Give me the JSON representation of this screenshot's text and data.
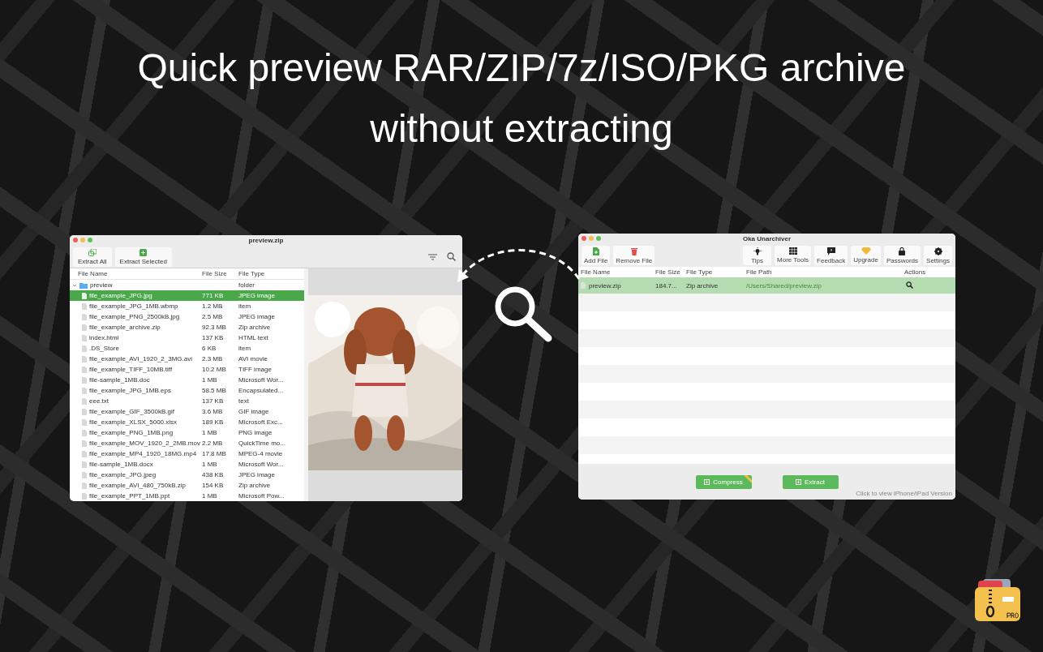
{
  "headline": "Quick preview RAR/ZIP/7z/ISO/PKG archive without extracting",
  "preview_window": {
    "title": "preview.zip",
    "toolbar": [
      {
        "label": "Extract All"
      },
      {
        "label": "Extract Selected"
      }
    ],
    "columns": [
      "File Name",
      "File Size",
      "File Type"
    ],
    "tree": [
      {
        "name": "preview",
        "type": "folder",
        "expanded": true,
        "selected": false,
        "children": [
          {
            "name": "file_example_JPG.jpg",
            "size": "771 KB",
            "type": "JPEG image",
            "selected": true
          },
          {
            "name": "file_example_JPG_1MB.wbmp",
            "size": "1.2 MB",
            "type": "item",
            "selected": false
          },
          {
            "name": "file_example_PNG_2500kB.jpg",
            "size": "2.5 MB",
            "type": "JPEG image",
            "selected": false
          },
          {
            "name": "file_example_archive.zip",
            "size": "92.3 MB",
            "type": "Zip archive",
            "selected": false
          },
          {
            "name": "index.html",
            "size": "137 KB",
            "type": "HTML text",
            "selected": false
          },
          {
            "name": ".DS_Store",
            "size": "6 KB",
            "type": "item",
            "selected": false
          },
          {
            "name": "file_example_AVI_1920_2_3MG.avi",
            "size": "2.3 MB",
            "type": "AVI movie",
            "selected": false
          },
          {
            "name": "file_example_TIFF_10MB.tiff",
            "size": "10.2 MB",
            "type": "TIFF image",
            "selected": false
          },
          {
            "name": "file-sample_1MB.doc",
            "size": "1 MB",
            "type": "Microsoft Wor...",
            "selected": false
          },
          {
            "name": "file_example_JPG_1MB.eps",
            "size": "58.5 MB",
            "type": "Encapsulated...",
            "selected": false
          },
          {
            "name": "eee.txt",
            "size": "137 KB",
            "type": "text",
            "selected": false
          },
          {
            "name": "file_example_GIF_3500kB.gif",
            "size": "3.6 MB",
            "type": "GIF image",
            "selected": false
          },
          {
            "name": "file_example_XLSX_5000.xlsx",
            "size": "189 KB",
            "type": "Microsoft Exc...",
            "selected": false
          },
          {
            "name": "file_example_PNG_1MB.png",
            "size": "1 MB",
            "type": "PNG image",
            "selected": false
          },
          {
            "name": "file_example_MOV_1920_2_2MB.mov",
            "size": "2.2 MB",
            "type": "QuickTime mo...",
            "selected": false
          },
          {
            "name": "file_example_MP4_1920_18MG.mp4",
            "size": "17.8 MB",
            "type": "MPEG-4 movie",
            "selected": false
          },
          {
            "name": "file-sample_1MB.docx",
            "size": "1 MB",
            "type": "Microsoft Wor...",
            "selected": false
          },
          {
            "name": "file_example_JPG.jpeg",
            "size": "438 KB",
            "type": "JPEG image",
            "selected": false
          },
          {
            "name": "file_example_AVI_480_750kB.zip",
            "size": "154 KB",
            "type": "Zip archive",
            "selected": false
          },
          {
            "name": "file_example_PPT_1MB.ppt",
            "size": "1 MB",
            "type": "Microsoft Pow...",
            "selected": false
          }
        ]
      }
    ]
  },
  "unarchiver_window": {
    "title": "Oka Unarchiver",
    "toolbar_left": [
      {
        "label": "Add File"
      },
      {
        "label": "Remove File"
      }
    ],
    "toolbar_right": [
      {
        "label": "Tips"
      },
      {
        "label": "More Tools"
      },
      {
        "label": "Feedback"
      },
      {
        "label": "Upgrade"
      },
      {
        "label": "Passwords"
      },
      {
        "label": "Settings"
      }
    ],
    "columns": [
      "File Name",
      "File Size",
      "File Type",
      "File Path",
      "Actions"
    ],
    "rows": [
      {
        "name": "preview.zip",
        "size": "184.7...",
        "type": "Zip archive",
        "path": "/Users/Shared/preview.zip",
        "selected": true
      }
    ],
    "buttons": [
      {
        "label": "Compress",
        "pro": true
      },
      {
        "label": "Extract",
        "pro": false
      }
    ],
    "footer_link": "Click to view iPhone/iPad Version"
  }
}
